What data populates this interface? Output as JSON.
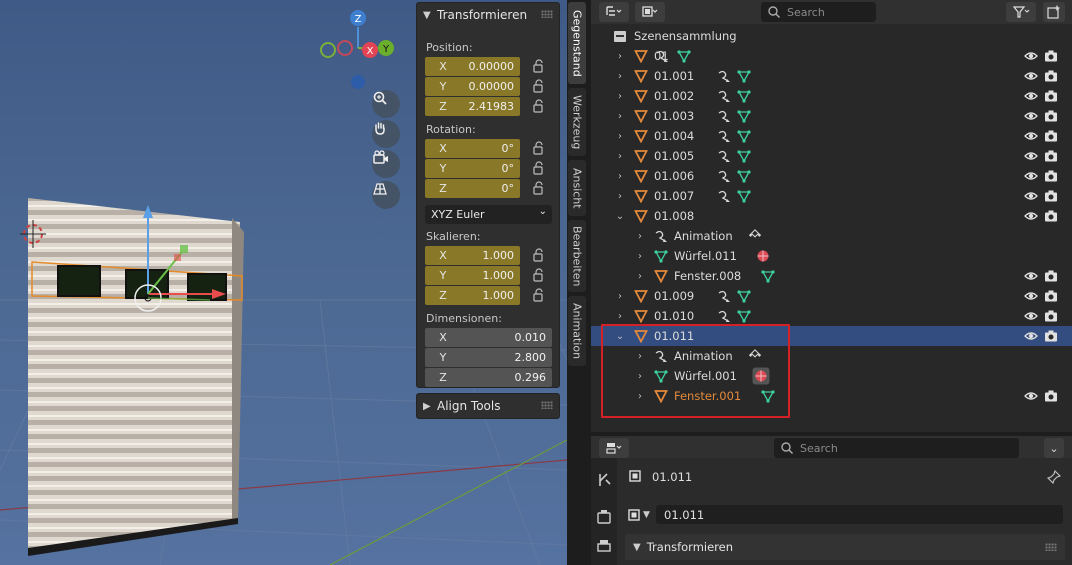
{
  "viewport": {
    "gizmo": {
      "z_label": "Z",
      "x_label": "X",
      "y_label": "Y"
    },
    "nav_buttons": [
      "zoom-icon",
      "hand-pan-icon",
      "camera-view-icon",
      "grid-ortho-icon"
    ]
  },
  "npanel": {
    "transform_title": "Transformieren",
    "position_label": "Position:",
    "position": [
      {
        "axis": "X",
        "value": "0.00000"
      },
      {
        "axis": "Y",
        "value": "0.00000"
      },
      {
        "axis": "Z",
        "value": "2.41983"
      }
    ],
    "rotation_label": "Rotation:",
    "rotation": [
      {
        "axis": "X",
        "value": "0°"
      },
      {
        "axis": "Y",
        "value": "0°"
      },
      {
        "axis": "Z",
        "value": "0°"
      }
    ],
    "rotation_mode": "XYZ Euler",
    "scale_label": "Skalieren:",
    "scale": [
      {
        "axis": "X",
        "value": "1.000"
      },
      {
        "axis": "Y",
        "value": "1.000"
      },
      {
        "axis": "Z",
        "value": "1.000"
      }
    ],
    "dimensions_label": "Dimensionen:",
    "dimensions": [
      {
        "axis": "X",
        "value": "0.010"
      },
      {
        "axis": "Y",
        "value": "2.800"
      },
      {
        "axis": "Z",
        "value": "0.296"
      }
    ],
    "align_tools_title": "Align Tools"
  },
  "sidebar_tabs": [
    "Gegenstand",
    "Werkzeug",
    "Ansicht",
    "Bearbeiten",
    "Animation"
  ],
  "outliner": {
    "search_placeholder": "Search",
    "collection": "Szenensammlung",
    "rows": [
      {
        "label": "01"
      },
      {
        "label": "01.001"
      },
      {
        "label": "01.002"
      },
      {
        "label": "01.003"
      },
      {
        "label": "01.004"
      },
      {
        "label": "01.005"
      },
      {
        "label": "01.006"
      },
      {
        "label": "01.007"
      },
      {
        "label": "01.008"
      },
      {
        "label": "Animation"
      },
      {
        "label": "Würfel.011"
      },
      {
        "label": "Fenster.008"
      },
      {
        "label": "01.009"
      },
      {
        "label": "01.010"
      },
      {
        "label": "01.011"
      },
      {
        "label": "Animation"
      },
      {
        "label": "Würfel.001"
      },
      {
        "label": "Fenster.001"
      }
    ],
    "selected_row": "01.011",
    "highlight_color": "#d42027"
  },
  "properties": {
    "search_placeholder": "Search",
    "object_name": "01.011",
    "object_field": "01.011",
    "panel_title": "Transformieren"
  },
  "colors": {
    "selection": "#334d80",
    "field_yellow": "#897827",
    "object_orange": "#e3893b",
    "mesh_green": "#3dd1a0"
  }
}
